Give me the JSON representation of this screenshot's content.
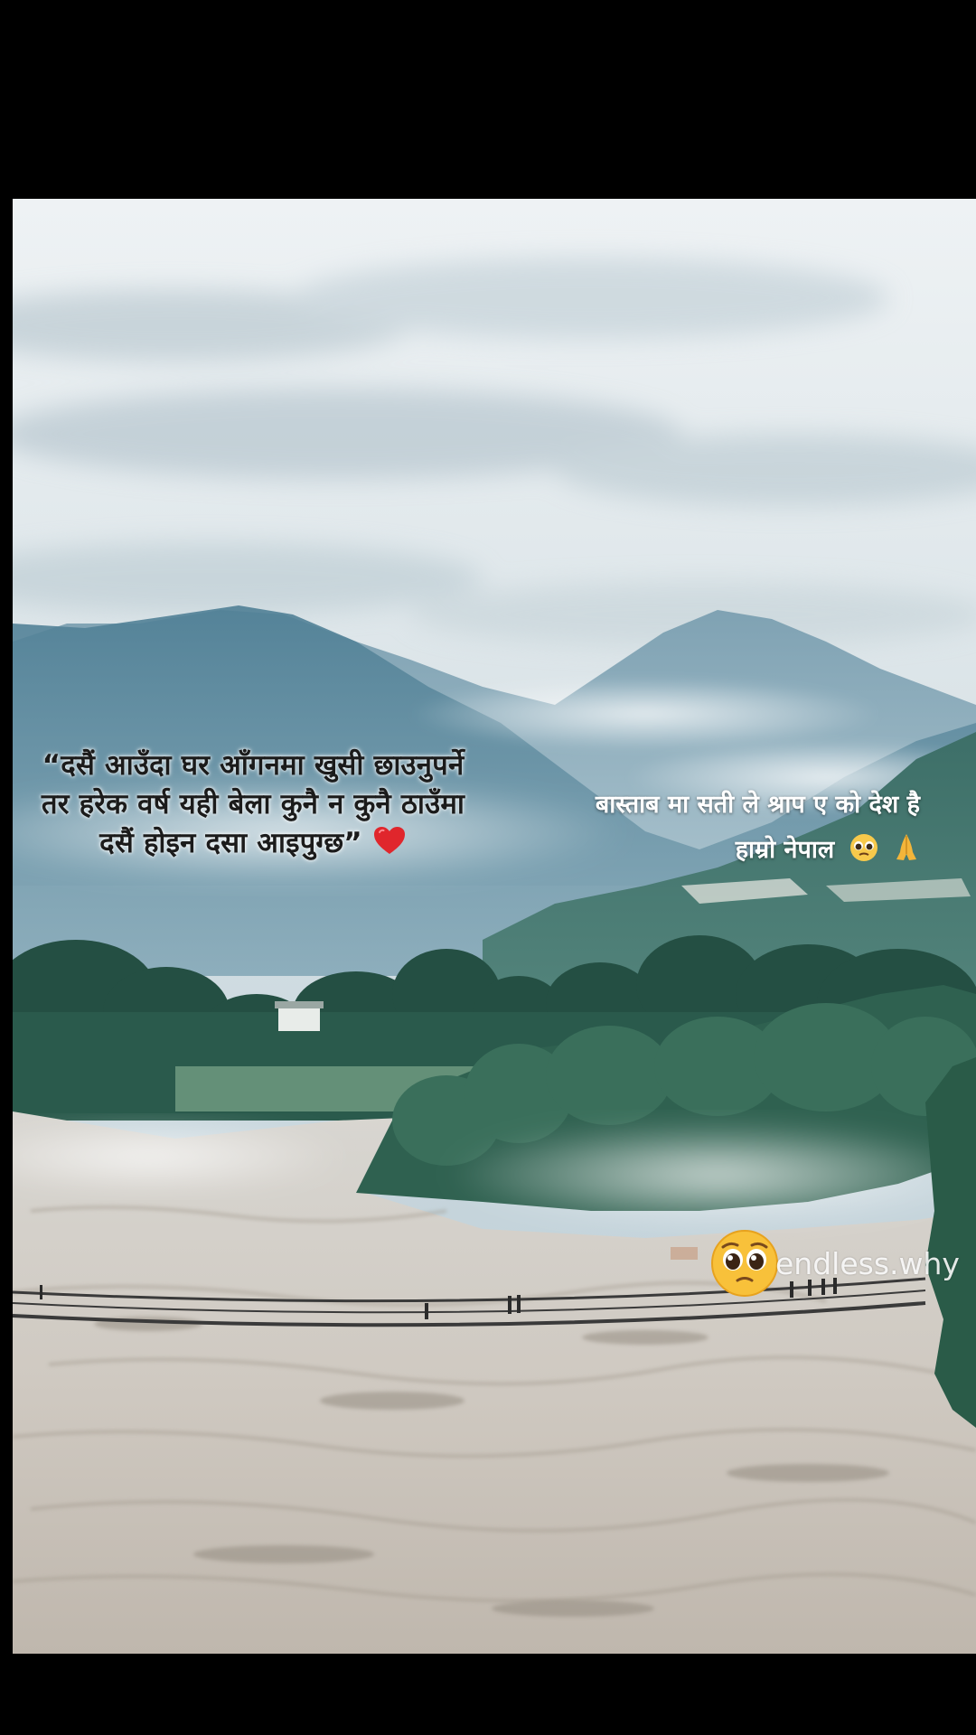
{
  "post": {
    "caption_left": "“दसैं आउँदा घर आँगनमा खुसी छाउनुपर्ने तर हरेक वर्ष यही बेला कुनै न कुनै ठाउँमा दसैं होइन दसा आइपुग्छ”",
    "caption_left_end_icon": "heart-emoji",
    "caption_right_line1": "बास्ताब मा सती ले श्राप ए को देश है",
    "caption_right_line2": "हाम्रो नेपाल",
    "caption_right_icons": [
      "pleading-face-emoji",
      "folded-hands-emoji"
    ]
  },
  "watermark": {
    "icon": "pleading-face-emoji",
    "text": "endless.why"
  },
  "colors": {
    "background": "#000000",
    "heart": "#e0262c",
    "sky": "#dfe6ea",
    "mountain": "#6f95a8",
    "river": "#d9d4cd",
    "forest": "#2f5e4c"
  }
}
